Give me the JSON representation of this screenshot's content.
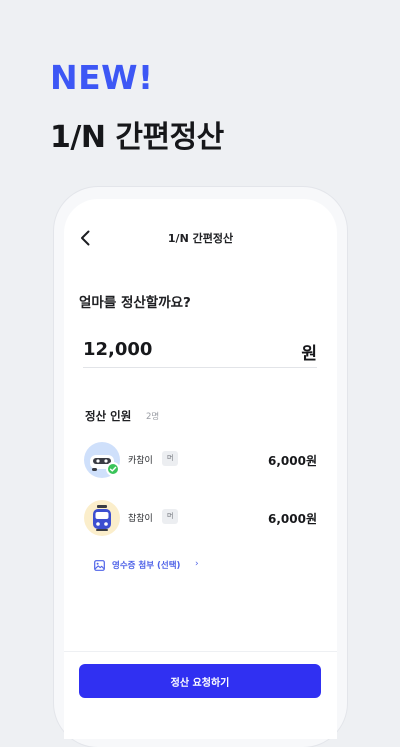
{
  "promo": {
    "badge": "NEW!",
    "title": "1/N 간편정산"
  },
  "nav": {
    "back_icon": "chevron-left-icon",
    "title": "1/N 간편정산"
  },
  "question": "얼마를 정산할까요?",
  "amount": {
    "value": "12,000",
    "unit": "원"
  },
  "participants": {
    "label": "정산 인원",
    "count": "2명",
    "items": [
      {
        "name": "카참이",
        "tag": "머",
        "amount": "6,000원",
        "avatar": "car-character-avatar",
        "avatar_color": "#cfe0fb",
        "verified": true
      },
      {
        "name": "찹참이",
        "tag": "머",
        "amount": "6,000원",
        "avatar": "train-character-avatar",
        "avatar_color": "#fbeecb",
        "verified": false
      }
    ]
  },
  "receipt": {
    "icon": "image-icon",
    "label": "영수증 첨부 (선택)",
    "chevron": "›"
  },
  "button": {
    "label": "정산 요청하기",
    "color": "#3030f2"
  },
  "colors": {
    "accent": "#3d57f5",
    "link": "#4f63e8",
    "background": "#eef0f3"
  }
}
